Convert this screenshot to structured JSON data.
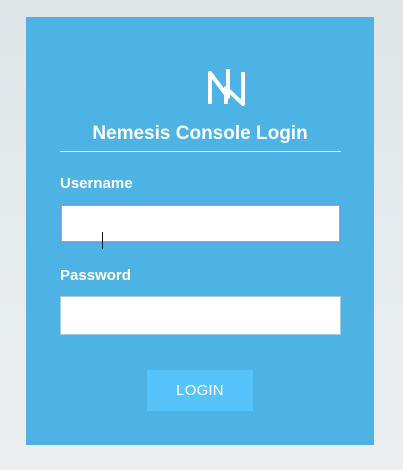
{
  "login": {
    "title": "Nemesis Console Login",
    "logo_icon": "nemesis-n-logo",
    "username": {
      "label": "Username",
      "value": "",
      "placeholder": ""
    },
    "password": {
      "label": "Password",
      "value": "",
      "placeholder": ""
    },
    "button_label": "LOGIN"
  },
  "colors": {
    "panel": "#4db3e4",
    "button": "#56c4fb",
    "text": "#ffffff",
    "background": "#e4e9ec"
  }
}
